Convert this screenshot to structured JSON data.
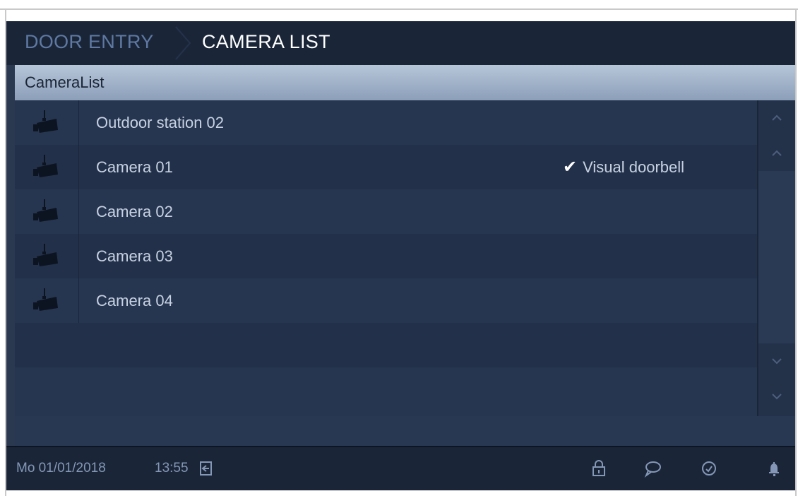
{
  "header": {
    "breadcrumb_parent": "DOOR ENTRY",
    "breadcrumb_current": "CAMERA LIST"
  },
  "list": {
    "title": "CameraList",
    "items": [
      {
        "label": "Outdoor station 02",
        "icon": "camera-icon",
        "flag": ""
      },
      {
        "label": "Camera 01",
        "icon": "camera-icon",
        "flag": "Visual doorbell",
        "flag_icon": "✔"
      },
      {
        "label": "Camera 02",
        "icon": "camera-icon",
        "flag": ""
      },
      {
        "label": "Camera 03",
        "icon": "camera-icon",
        "flag": ""
      },
      {
        "label": "Camera 04",
        "icon": "camera-icon",
        "flag": ""
      }
    ]
  },
  "scrollbar": {
    "page_up": "^",
    "line_up": "^",
    "line_down": "⌄",
    "page_down": "⌄"
  },
  "status_bar": {
    "date": "Mo 01/01/2018",
    "time": "13:55",
    "icons": [
      "exit-icon",
      "lock-icon",
      "message-icon",
      "history-icon",
      "bell-icon"
    ]
  },
  "colors": {
    "screen_bg": "#2a3850",
    "header_bg": "#1a2638",
    "title_bar": "#9fb1c9",
    "text": "#c7d2e2"
  }
}
